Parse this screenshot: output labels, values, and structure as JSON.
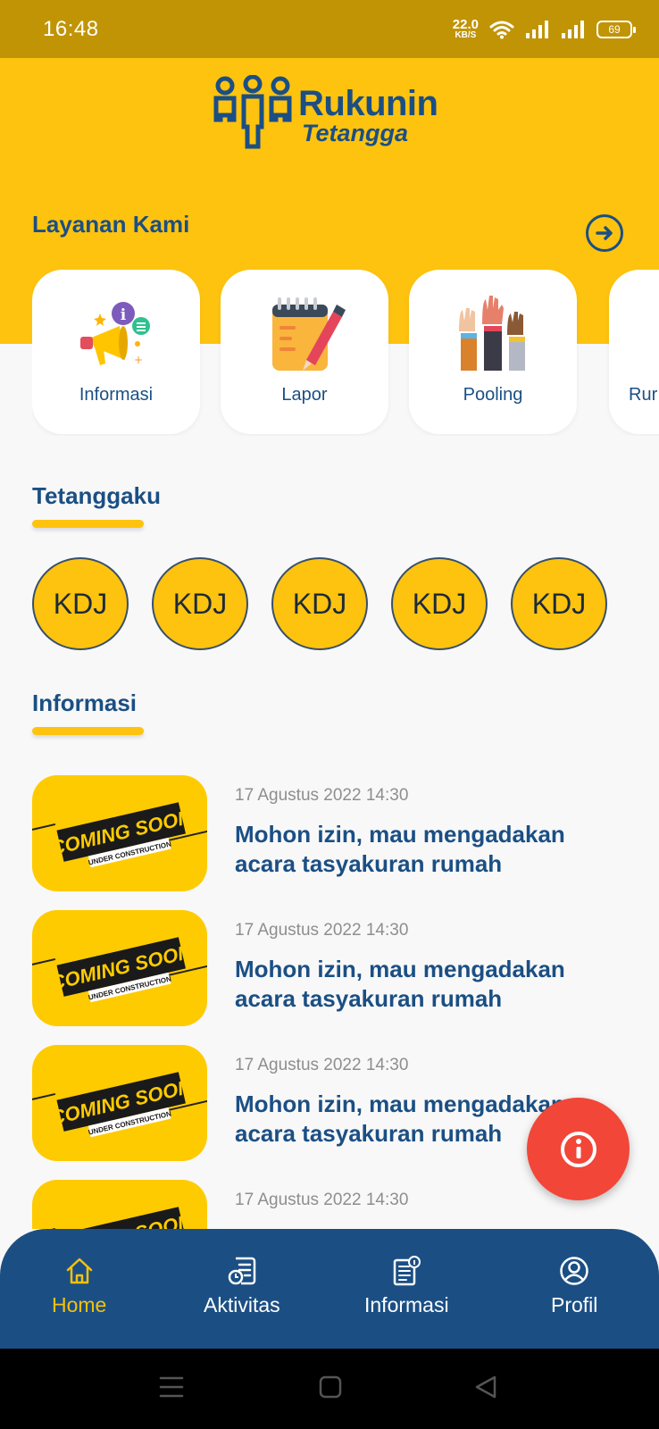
{
  "status_bar": {
    "time": "16:48",
    "net_speed_value": "22.0",
    "net_speed_unit": "KB/S",
    "battery": "69"
  },
  "logo": {
    "title": "Rukunin",
    "subtitle": "Tetangga"
  },
  "services_section": {
    "title": "Layanan Kami",
    "items": [
      {
        "label": "Informasi",
        "icon": "megaphone-icon"
      },
      {
        "label": "Lapor",
        "icon": "notepad-pen-icon"
      },
      {
        "label": "Pooling",
        "icon": "raised-hands-icon"
      },
      {
        "label": "Rur",
        "icon": "partial-card"
      }
    ]
  },
  "neighbors_section": {
    "title": "Tetanggaku",
    "avatars": [
      "KDJ",
      "KDJ",
      "KDJ",
      "KDJ",
      "KDJ"
    ]
  },
  "info_section": {
    "title": "Informasi",
    "items": [
      {
        "date": "17 Agustus 2022 14:30",
        "title": "Mohon izin, mau mengadakan acara tasyakuran rumah",
        "thumb_main": "COMING SOON",
        "thumb_sub": "UNDER CONSTRUCTION"
      },
      {
        "date": "17 Agustus 2022 14:30",
        "title": "Mohon izin, mau mengadakan acara tasyakuran rumah",
        "thumb_main": "COMING SOON",
        "thumb_sub": "UNDER CONSTRUCTION"
      },
      {
        "date": "17 Agustus 2022 14:30",
        "title": "Mohon izin, mau mengadakan acara tasyakuran rumah",
        "thumb_main": "COMING SOON",
        "thumb_sub": "UNDER CONSTRUCTION"
      },
      {
        "date": "17 Agustus 2022 14:30",
        "title": "",
        "thumb_main": "COMING SOON",
        "thumb_sub": ""
      }
    ]
  },
  "bottom_nav": {
    "items": [
      {
        "label": "Home",
        "icon": "home-icon",
        "active": true
      },
      {
        "label": "Aktivitas",
        "icon": "activity-icon",
        "active": false
      },
      {
        "label": "Informasi",
        "icon": "info-doc-icon",
        "active": false
      },
      {
        "label": "Profil",
        "icon": "profile-icon",
        "active": false
      }
    ]
  },
  "colors": {
    "primary_yellow": "#fec30f",
    "primary_blue": "#1b4f84",
    "fab_red": "#f24638",
    "status_bar": "#c19406"
  }
}
